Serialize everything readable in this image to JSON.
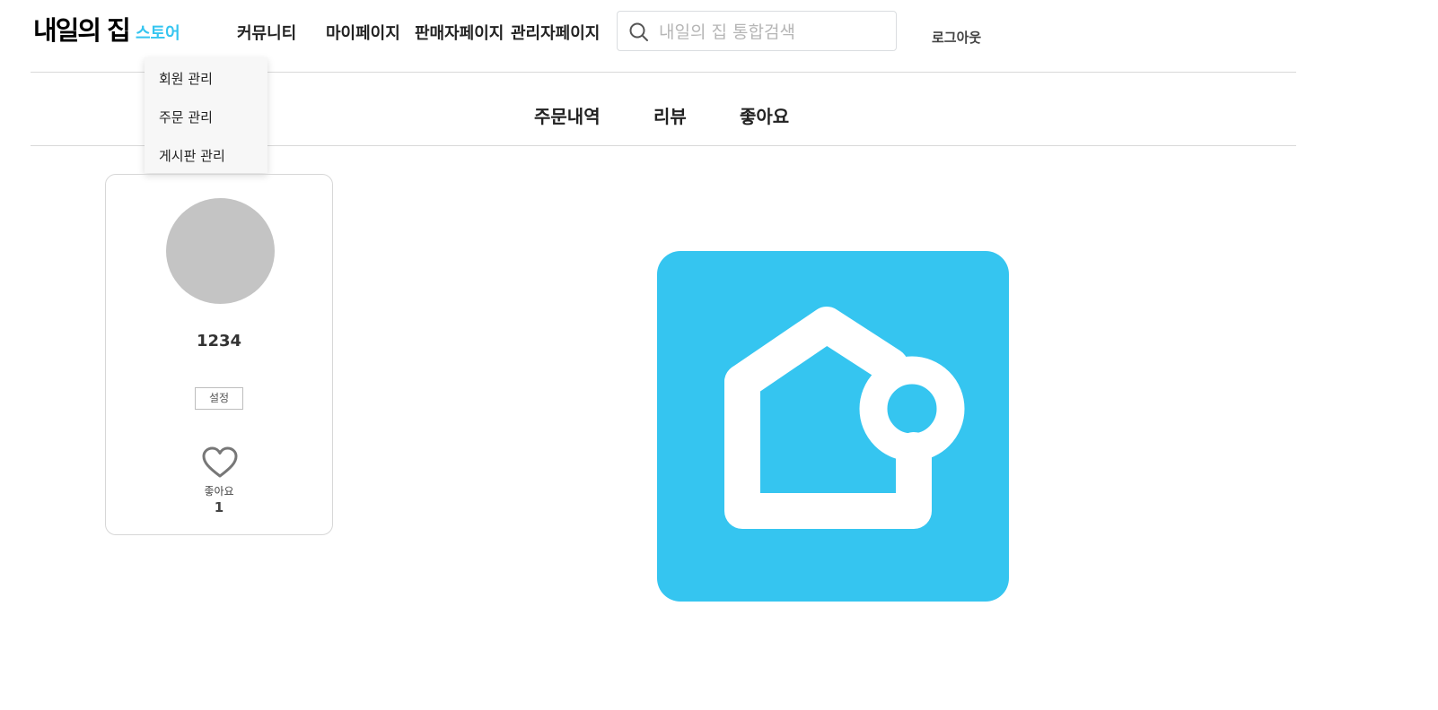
{
  "header": {
    "logo_text": "내일의 집",
    "nav": {
      "store": "스토어",
      "community": "커뮤니티",
      "mypage": "마이페이지",
      "seller": "판매자페이지",
      "admin": "관리자페이지"
    },
    "search": {
      "placeholder": "내일의 집 통합검색",
      "value": ""
    },
    "logout": "로그아웃"
  },
  "dropdown": {
    "items": [
      "회원 관리",
      "주문 관리",
      "게시판 관리"
    ]
  },
  "tabs": [
    "주문내역",
    "리뷰",
    "좋아요"
  ],
  "profile": {
    "username": "1234",
    "settings_label": "설정",
    "like_label": "좋아요",
    "like_count": "1"
  },
  "colors": {
    "accent": "#35c5f0",
    "avatar": "#c4c4c4"
  },
  "icons": [
    "search-icon",
    "heart-icon",
    "house-logo-icon"
  ]
}
